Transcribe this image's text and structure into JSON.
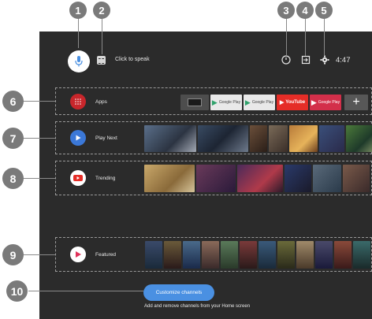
{
  "top_bar": {
    "speak_hint": "Click to speak",
    "time": "4:47",
    "icons": [
      "mic-icon",
      "keyboard-icon",
      "timer-icon",
      "input-icon",
      "gear-icon"
    ]
  },
  "rows": {
    "apps": {
      "label": "Apps",
      "tiles": [
        "",
        "Google Play",
        "Google Play",
        "YouTube",
        "Google Play"
      ]
    },
    "play_next": {
      "label": "Play Next"
    },
    "trending": {
      "label": "Trending"
    },
    "featured": {
      "label": "Featured"
    }
  },
  "customize": {
    "button_label": "Customize channels",
    "hint": "Add and remove channels from your Home screen"
  },
  "callouts": [
    "1",
    "2",
    "3",
    "4",
    "5",
    "6",
    "7",
    "8",
    "9",
    "10"
  ],
  "colors": {
    "screen_bg": "#2b2b2b",
    "callout": "#7a7a7a",
    "accent_blue": "#4a90e2",
    "apps_red": "#c8262b",
    "youtube_red": "#e52d27"
  }
}
